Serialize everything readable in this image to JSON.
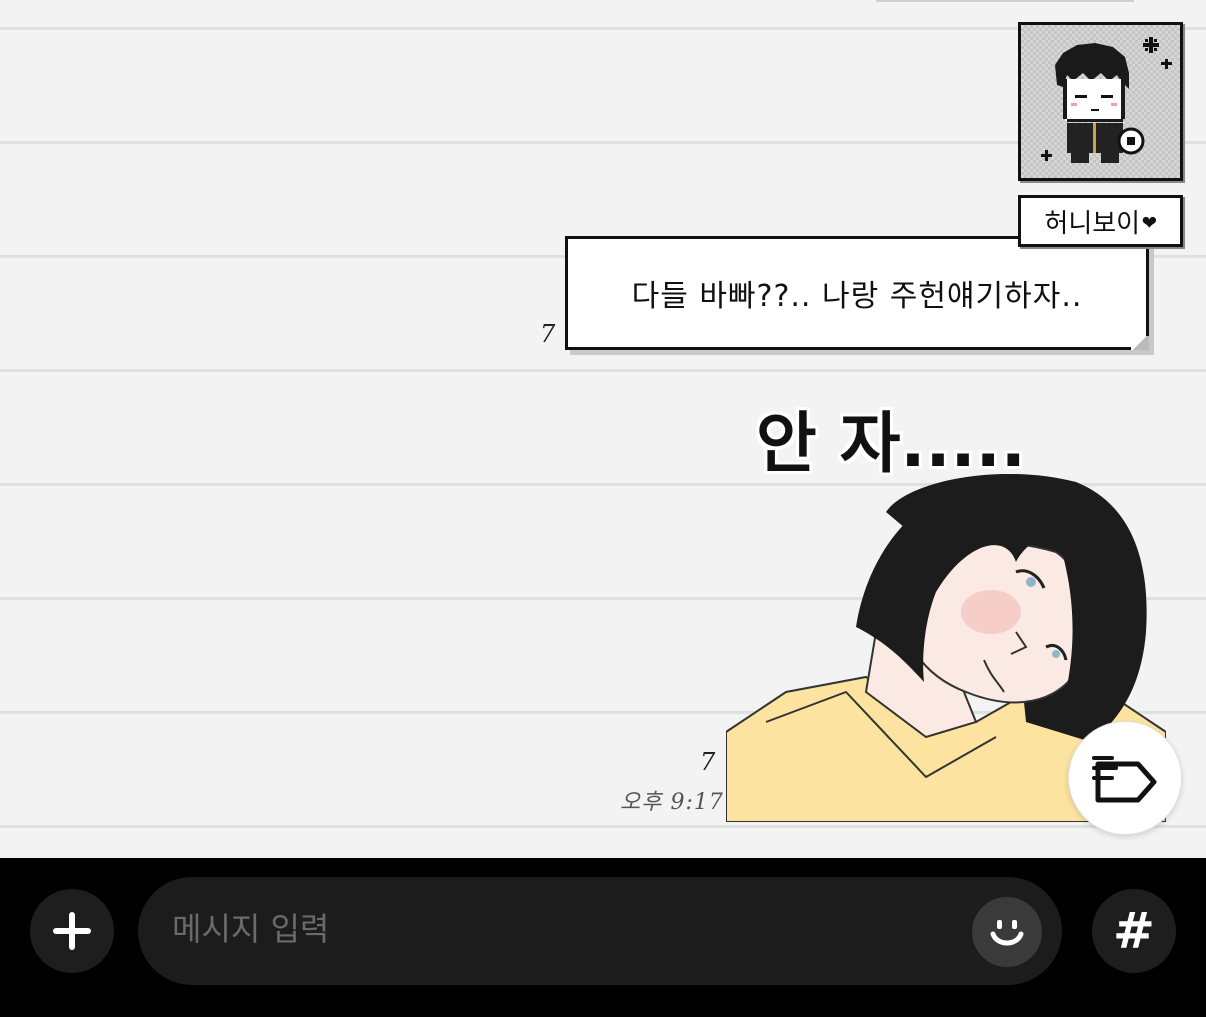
{
  "chat": {
    "sender": {
      "name": "허니보이",
      "name_suffix_icon": "heart-icon",
      "avatar_icon": "pixel-boy-avatar"
    },
    "messages": [
      {
        "type": "text",
        "text": "다들 바빠??.. 나랑 주헌얘기하자..",
        "unread_count": "7"
      },
      {
        "type": "sticker",
        "caption": "안 자.....",
        "sticker_icon": "sleepy-girl-sticker",
        "unread_count": "7",
        "time": "오후 9:17"
      }
    ],
    "tag_button_icon": "tag-list-icon"
  },
  "composer": {
    "placeholder": "메시지 입력",
    "value": "",
    "plus_icon": "plus-icon",
    "emoji_icon": "smiley-icon",
    "hash_label": "#"
  },
  "colors": {
    "background": "#f3f3f3",
    "rule_line": "#e0e0e0",
    "bottom_bar": "#000000",
    "input_bg": "#1c1c1c",
    "sticker_hoodie": "#fde3a0"
  }
}
